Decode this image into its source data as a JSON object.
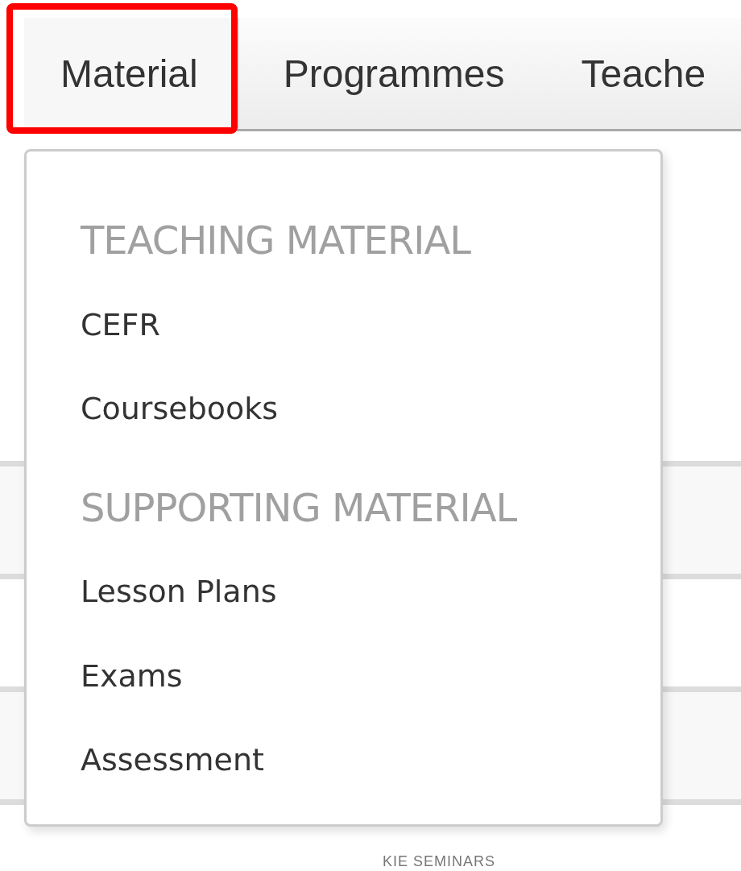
{
  "tabs": [
    {
      "label": "Material",
      "selected": true,
      "highlighted": true
    },
    {
      "label": "Programmes",
      "selected": false,
      "highlighted": false
    },
    {
      "label": "Teache",
      "selected": false,
      "highlighted": false
    }
  ],
  "dropdown": {
    "items": [
      {
        "kind": "header",
        "label": "TEACHING MATERIAL"
      },
      {
        "kind": "link",
        "label": "CEFR"
      },
      {
        "kind": "link",
        "label": "Coursebooks"
      },
      {
        "kind": "header",
        "label": "SUPPORTING MATERIAL"
      },
      {
        "kind": "link",
        "label": "Lesson Plans"
      },
      {
        "kind": "link",
        "label": "Exams"
      },
      {
        "kind": "link",
        "label": "Assessment"
      }
    ]
  },
  "footer_heading": "KIE SEMINARS"
}
